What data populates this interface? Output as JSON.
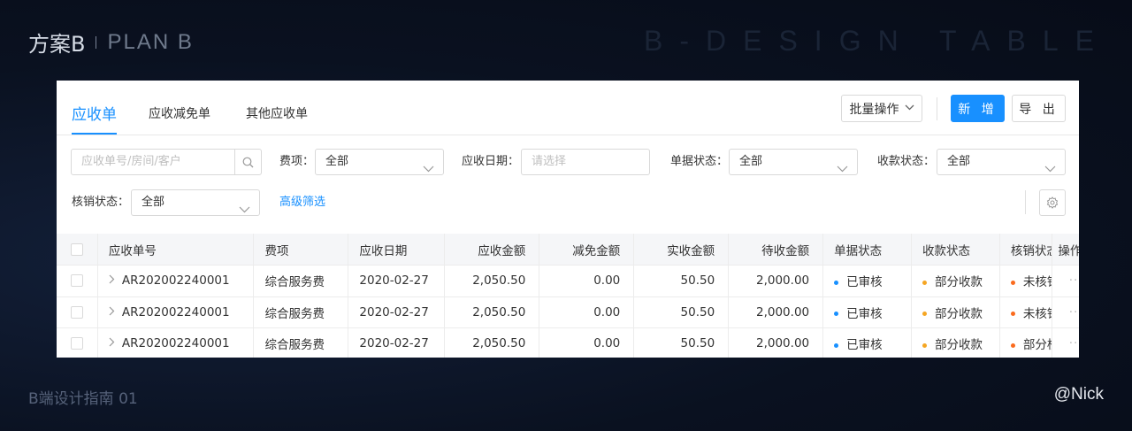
{
  "header": {
    "title": "方案B",
    "plan": "PLAN B",
    "watermark": "B-DESIGN TABLE"
  },
  "footer": {
    "left": "B端设计指南 01",
    "right": "@Nick"
  },
  "colors": {
    "accent": "#1890ff",
    "status_blue": "#1890ff",
    "status_yellow": "#f5a623",
    "status_orange": "#fa6b1e"
  },
  "tabs": [
    {
      "label": "应收单",
      "active": true
    },
    {
      "label": "应收减免单",
      "active": false
    },
    {
      "label": "其他应收单",
      "active": false
    }
  ],
  "toolbar": {
    "batch_label": "批量操作",
    "new_label": "新 增",
    "export_label": "导 出"
  },
  "filters": {
    "search_placeholder": "应收单号/房间/客户",
    "fee_label": "费项：",
    "fee_value": "全部",
    "date_label": "应收日期：",
    "date_placeholder": "请选择",
    "doc_status_label": "单据状态：",
    "doc_status_value": "全部",
    "collect_status_label": "收款状态：",
    "collect_status_value": "全部",
    "writeoff_status_label": "核销状态：",
    "writeoff_status_value": "全部",
    "advanced_label": "高级筛选"
  },
  "table": {
    "columns": [
      "应收单号",
      "费项",
      "应收日期",
      "应收金额",
      "减免金额",
      "实收金额",
      "待收金额",
      "单据状态",
      "收款状态",
      "核销状态",
      "操作"
    ],
    "rows": [
      {
        "id": "AR202002240001",
        "fee": "综合服务费",
        "date": "2020-02-27",
        "receivable": "2,050.50",
        "relief": "0.00",
        "received": "50.50",
        "pending": "2,000.00",
        "doc_status": "已审核",
        "collect_status": "部分收款",
        "writeoff_status": "未核销",
        "op": "···"
      },
      {
        "id": "AR202002240001",
        "fee": "综合服务费",
        "date": "2020-02-27",
        "receivable": "2,050.50",
        "relief": "0.00",
        "received": "50.50",
        "pending": "2,000.00",
        "doc_status": "已审核",
        "collect_status": "部分收款",
        "writeoff_status": "未核销",
        "op": "···"
      },
      {
        "id": "AR202002240001",
        "fee": "综合服务费",
        "date": "2020-02-27",
        "receivable": "2,050.50",
        "relief": "0.00",
        "received": "50.50",
        "pending": "2,000.00",
        "doc_status": "已审核",
        "collect_status": "部分收款",
        "writeoff_status": "部分核销",
        "op": "···"
      }
    ]
  }
}
